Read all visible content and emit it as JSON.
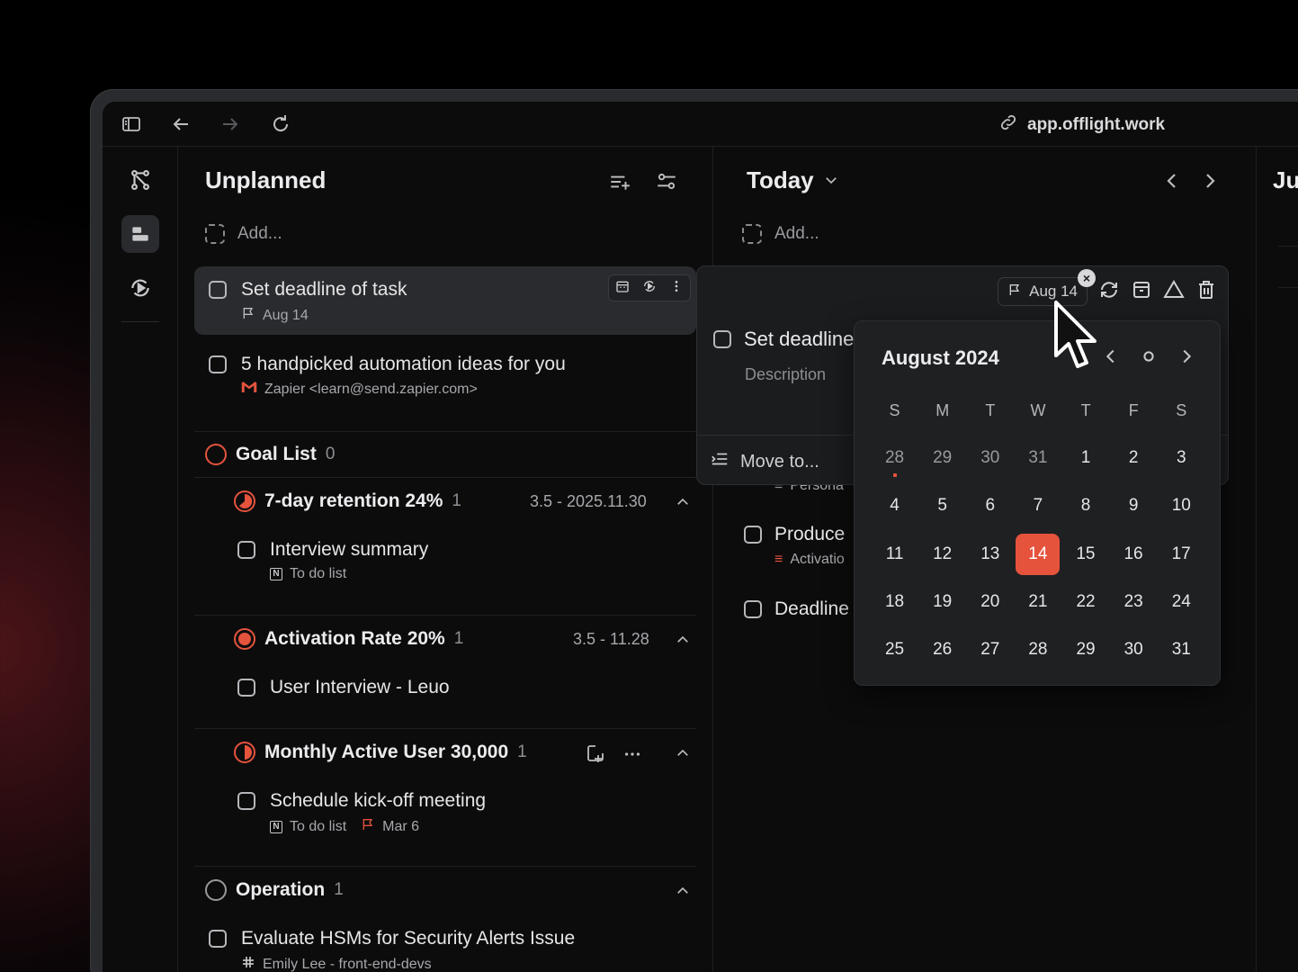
{
  "browser": {
    "url": "app.offlight.work"
  },
  "unplanned": {
    "title": "Unplanned",
    "add_placeholder": "Add...",
    "tasks": [
      {
        "title": "Set deadline of task",
        "meta": "Aug 14"
      },
      {
        "title": "5 handpicked automation ideas for you",
        "meta": "Zapier <learn@send.zapier.com>"
      }
    ],
    "goals": [
      {
        "name": "Goal List",
        "count": "0"
      },
      {
        "name": "7-day retention 24%",
        "count": "1",
        "range": "3.5 - 2025.11.30",
        "tasks": [
          {
            "title": "Interview summary",
            "meta": "To do list"
          }
        ]
      },
      {
        "name": "Activation Rate 20%",
        "count": "1",
        "range": "3.5 - 11.28",
        "tasks": [
          {
            "title": "User Interview - Leuo"
          }
        ]
      },
      {
        "name": "Monthly Active User 30,000",
        "count": "1",
        "tasks": [
          {
            "title": "Schedule kick-off meeting",
            "meta": "To do list",
            "date": "Mar 6"
          }
        ]
      },
      {
        "name": "Operation",
        "count": "1",
        "tasks": [
          {
            "title": "Evaluate HSMs for Security Alerts Issue",
            "meta": "Emily Lee - front-end-devs"
          }
        ]
      }
    ]
  },
  "today": {
    "title": "Today",
    "add_placeholder": "Add...",
    "tasks": [
      {
        "title": "Produce",
        "meta": "Activatio"
      },
      {
        "title": "Deadline"
      }
    ],
    "partial_meta": "Persona"
  },
  "third_col": {
    "title": "Ju"
  },
  "detail": {
    "date_chip": "Aug 14",
    "task_title": "Set deadline",
    "description_placeholder": "Description",
    "move_to": "Move to..."
  },
  "calendar": {
    "month": "August 2024",
    "weekdays": [
      "S",
      "M",
      "T",
      "W",
      "T",
      "F",
      "S"
    ],
    "weeks": [
      [
        "28",
        "29",
        "30",
        "31",
        "1",
        "2",
        "3"
      ],
      [
        "4",
        "5",
        "6",
        "7",
        "8",
        "9",
        "10"
      ],
      [
        "11",
        "12",
        "13",
        "14",
        "15",
        "16",
        "17"
      ],
      [
        "18",
        "19",
        "20",
        "21",
        "22",
        "23",
        "24"
      ],
      [
        "25",
        "26",
        "27",
        "28",
        "29",
        "30",
        "31"
      ]
    ],
    "selected": "14",
    "accent": "#e5533d"
  }
}
